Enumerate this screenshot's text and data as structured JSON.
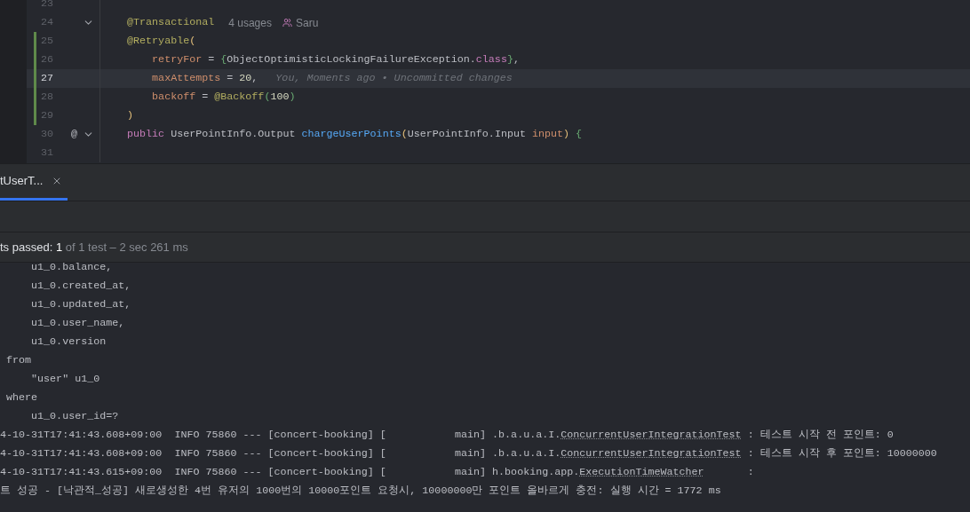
{
  "editor": {
    "lines": [
      {
        "number": "23",
        "current": false,
        "changed": false,
        "fold": false
      },
      {
        "number": "24",
        "current": false,
        "changed": false,
        "fold": true,
        "code": [
          {
            "text": "    @Transactional",
            "kind": "annotation"
          }
        ],
        "hints": [
          {
            "kind": "usages",
            "text": "4 usages"
          },
          {
            "kind": "author",
            "text": "Saru"
          }
        ]
      },
      {
        "number": "25",
        "current": false,
        "changed": true,
        "fold": false,
        "code": [
          {
            "text": "    @Retryable",
            "kind": "annotation"
          },
          {
            "text": "(",
            "kind": "bracket1"
          }
        ]
      },
      {
        "number": "26",
        "current": false,
        "changed": true,
        "fold": false,
        "code": [
          {
            "text": "        retryFor",
            "kind": "param"
          },
          {
            "text": " = ",
            "kind": "plain"
          },
          {
            "text": "{",
            "kind": "bracket2"
          },
          {
            "text": "ObjectOptimisticLockingFailureException.",
            "kind": "plain"
          },
          {
            "text": "class",
            "kind": "keyword"
          },
          {
            "text": "}",
            "kind": "bracket2"
          },
          {
            "text": ",",
            "kind": "plain"
          }
        ]
      },
      {
        "number": "27",
        "current": true,
        "changed": true,
        "fold": false,
        "code": [
          {
            "text": "        maxAttempts",
            "kind": "param"
          },
          {
            "text": " = ",
            "kind": "plain"
          },
          {
            "text": "20",
            "kind": "number"
          },
          {
            "text": ",",
            "kind": "plain"
          }
        ],
        "hints": [
          {
            "kind": "blame",
            "text": "You, Moments ago • Uncommitted changes"
          }
        ]
      },
      {
        "number": "28",
        "current": false,
        "changed": true,
        "fold": false,
        "code": [
          {
            "text": "        backoff",
            "kind": "param"
          },
          {
            "text": " = ",
            "kind": "plain"
          },
          {
            "text": "@Backoff",
            "kind": "annotation"
          },
          {
            "text": "(",
            "kind": "bracket2"
          },
          {
            "text": "100",
            "kind": "number"
          },
          {
            "text": ")",
            "kind": "bracket2"
          }
        ]
      },
      {
        "number": "29",
        "current": false,
        "changed": true,
        "fold": false,
        "code": [
          {
            "text": "    )",
            "kind": "bracket1"
          }
        ]
      },
      {
        "number": "30",
        "current": false,
        "changed": false,
        "fold": true,
        "gutter_mark": "@",
        "code": [
          {
            "text": "    public",
            "kind": "keyword"
          },
          {
            "text": " UserPointInfo.Output ",
            "kind": "plain"
          },
          {
            "text": "chargeUserPoints",
            "kind": "method"
          },
          {
            "text": "(",
            "kind": "bracket1"
          },
          {
            "text": "UserPointInfo.Input ",
            "kind": "plain"
          },
          {
            "text": "input",
            "kind": "param"
          },
          {
            "text": ") ",
            "kind": "bracket1"
          },
          {
            "text": "{",
            "kind": "bracket2"
          }
        ]
      },
      {
        "number": "31",
        "current": false,
        "changed": false,
        "fold": false
      }
    ]
  },
  "run_panel": {
    "tabs": [
      {
        "label": "tUserT...",
        "selected": true
      }
    ],
    "status": {
      "label": "ts passed:",
      "count": "1",
      "detail": "of 1 test – 2 sec 261 ms"
    },
    "console": [
      [
        {
          "text": "     u1_0.balance,",
          "kind": "plain"
        }
      ],
      [
        {
          "text": "     u1_0.created_at,",
          "kind": "plain"
        }
      ],
      [
        {
          "text": "     u1_0.updated_at,",
          "kind": "plain"
        }
      ],
      [
        {
          "text": "     u1_0.user_name,",
          "kind": "plain"
        }
      ],
      [
        {
          "text": "     u1_0.version",
          "kind": "plain"
        }
      ],
      [
        {
          "text": " from",
          "kind": "plain"
        }
      ],
      [
        {
          "text": "     \"user\" u1_0",
          "kind": "plain"
        }
      ],
      [
        {
          "text": " where",
          "kind": "plain"
        }
      ],
      [
        {
          "text": "     u1_0.user_id=?",
          "kind": "plain"
        }
      ],
      [
        {
          "text": "4-10-31T17:41:43.608+09:00  INFO 75860 --- [concert-booking] [           main] .b.a.u.a.I.",
          "kind": "plain"
        },
        {
          "text": "ConcurrentUserIntegrationTest",
          "kind": "link"
        },
        {
          "text": " : 테스트 시작 전 포인트: 0",
          "kind": "plain"
        }
      ],
      [
        {
          "text": "4-10-31T17:41:43.608+09:00  INFO 75860 --- [concert-booking] [           main] .b.a.u.a.I.",
          "kind": "plain"
        },
        {
          "text": "ConcurrentUserIntegrationTest",
          "kind": "link"
        },
        {
          "text": " : 테스트 시작 후 포인트: 10000000",
          "kind": "plain"
        }
      ],
      [
        {
          "text": "4-10-31T17:41:43.615+09:00  INFO 75860 --- [concert-booking] [           main] h.booking.app.",
          "kind": "plain"
        },
        {
          "text": "ExecutionTimeWatcher",
          "kind": "link"
        },
        {
          "text": "       :",
          "kind": "plain"
        }
      ],
      [
        {
          "text": "트 성공 - [낙관적_성공] 새로생성한 4번 유저의 1000번의 10000포인트 요청시, 10000000만 포인트 올바르게 충전: 실행 시간 = 1772 ms",
          "kind": "plain"
        }
      ]
    ]
  }
}
